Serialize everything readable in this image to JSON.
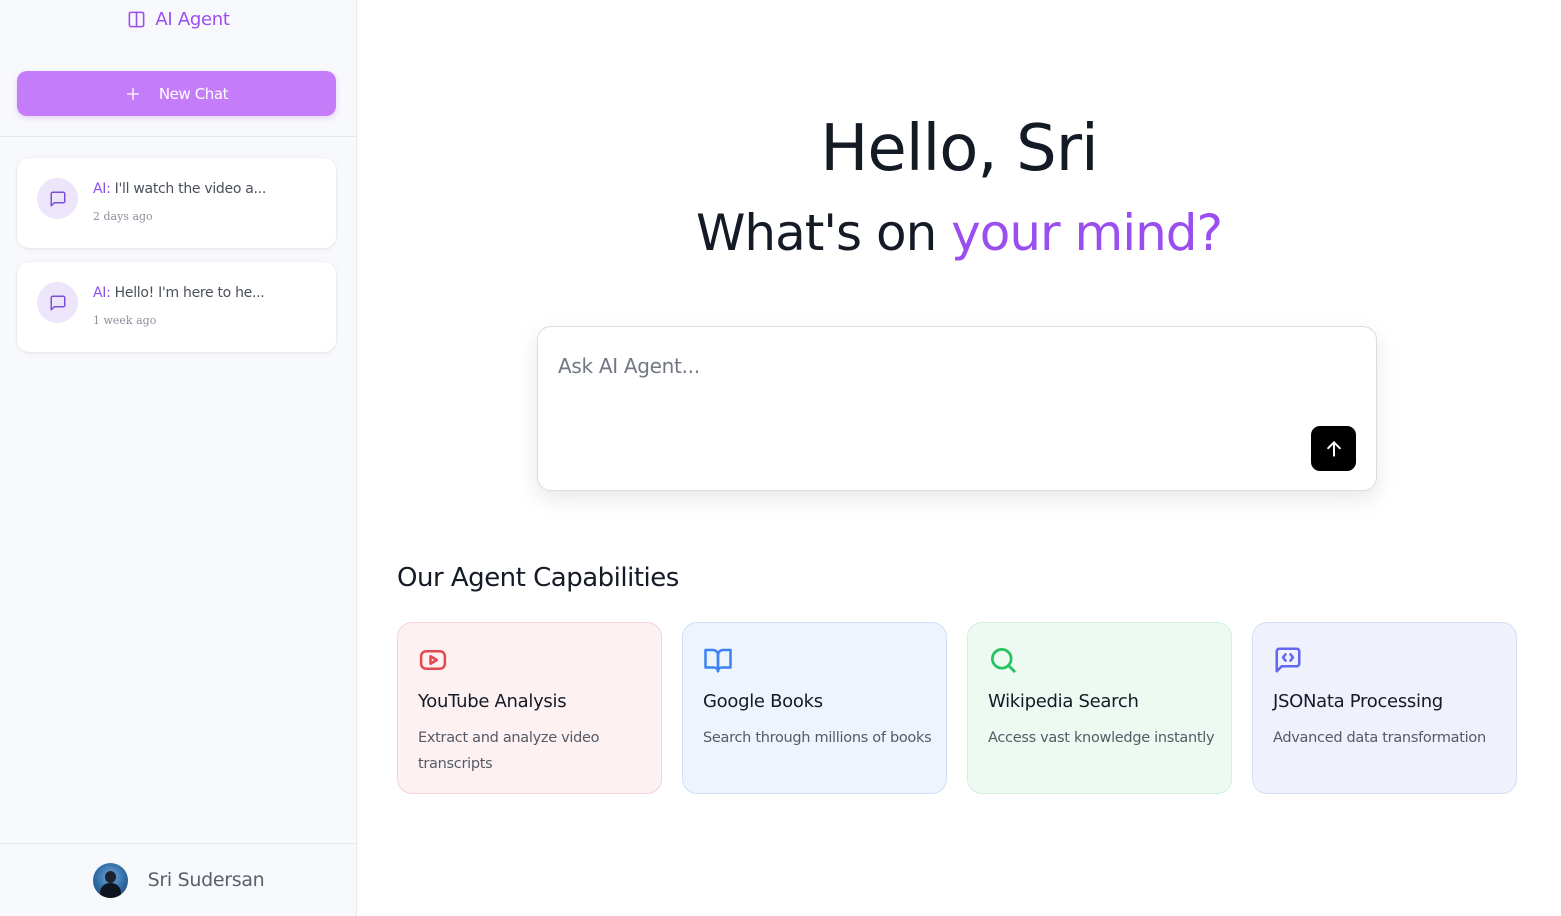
{
  "app": {
    "brand_label": "AI Agent",
    "accent_color": "#9b4ef0"
  },
  "sidebar": {
    "new_chat_label": "New Chat",
    "new_chat_icon": "plus-icon",
    "chats": [
      {
        "prefix": "AI:",
        "preview": " I'll watch the video a...",
        "time": "2 days ago",
        "icon": "message-square-icon"
      },
      {
        "prefix": "AI:",
        "preview": " Hello! I'm here to he...",
        "time": "1 week ago",
        "icon": "message-square-icon"
      }
    ],
    "user": {
      "name": "Sri Sudersan"
    }
  },
  "main": {
    "greeting": "Hello, Sri",
    "subheading_plain": "What's on ",
    "subheading_accent": "your mind?",
    "prompt": {
      "placeholder": "Ask AI Agent...",
      "value": "",
      "send_icon": "arrow-up-icon"
    },
    "capabilities_title": "Our Agent Capabilities",
    "capabilities": [
      {
        "title": "YouTube Analysis",
        "description": "Extract and analyze video transcripts",
        "icon": "youtube-icon",
        "color": "#e5484d"
      },
      {
        "title": "Google Books",
        "description": "Search through millions of books",
        "icon": "book-open-icon",
        "color": "#3b82f6"
      },
      {
        "title": "Wikipedia Search",
        "description": "Access vast knowledge instantly",
        "icon": "search-icon",
        "color": "#22c55e"
      },
      {
        "title": "JSONata Processing",
        "description": "Advanced data transformation",
        "icon": "message-code-icon",
        "color": "#6366f1"
      }
    ]
  }
}
